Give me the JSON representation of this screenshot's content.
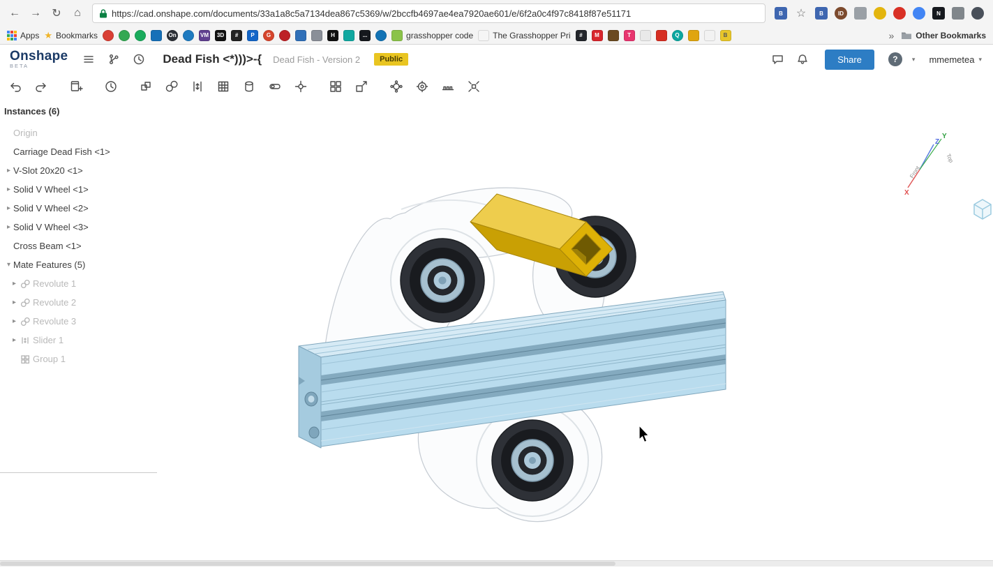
{
  "browser": {
    "url": "https://cad.onshape.com/documents/33a1a8c5a7134dea867c5369/w/2bccfb4697ae4ea7920ae601/e/6f2a0c4f97c8418f87e51171",
    "extensions": [
      {
        "letter": "B",
        "color": "#3e66b0"
      },
      {
        "letter": "ID",
        "color": "#7c4a2d",
        "shape": "circle"
      },
      {
        "letter": "",
        "color": "#9aa0a6"
      },
      {
        "letter": "",
        "color": "#e3b50e",
        "shape": "circle"
      },
      {
        "letter": "",
        "color": "#d93025",
        "shape": "circle"
      },
      {
        "letter": "",
        "color": "#4285f4",
        "shape": "circle"
      },
      {
        "letter": "N",
        "color": "#16191e"
      },
      {
        "letter": "",
        "color": "#80868b"
      },
      {
        "letter": "",
        "color": "#49505a",
        "shape": "circle"
      }
    ],
    "bookmarks": {
      "apps": "Apps",
      "bookmarks_label": "Bookmarks",
      "left_favicons": [
        {
          "letter": "",
          "color": "#d93f34",
          "shape": "circle"
        },
        {
          "letter": "",
          "color": "#34a853",
          "shape": "circle"
        },
        {
          "letter": "",
          "color": "#1aab5c",
          "shape": "circle"
        },
        {
          "letter": "",
          "color": "#1670b8"
        },
        {
          "letter": "On",
          "color": "#2b2f36",
          "shape": "circle"
        },
        {
          "letter": "",
          "color": "#1f7bc0",
          "shape": "circle"
        },
        {
          "letter": "VM",
          "color": "#5f3f8f"
        },
        {
          "letter": "3D",
          "color": "#111111"
        },
        {
          "letter": "#",
          "color": "#222222"
        },
        {
          "letter": "P",
          "color": "#1466c8"
        },
        {
          "letter": "G",
          "color": "#d6452c",
          "shape": "circle"
        },
        {
          "letter": "",
          "color": "#bd2126",
          "shape": "circle"
        },
        {
          "letter": "",
          "color": "#2f6fb8"
        },
        {
          "letter": "",
          "color": "#8a8f98"
        },
        {
          "letter": "H",
          "color": "#101010"
        },
        {
          "letter": "",
          "color": "#11a8a0"
        },
        {
          "letter": "...",
          "color": "#15181d"
        },
        {
          "letter": "",
          "color": "#1273b5",
          "shape": "circle"
        }
      ],
      "grasshopper": "grasshopper code",
      "grasshopper_icon_color": "#8bc34a",
      "grasshopper_pri": "The Grasshopper Pri",
      "page_icon_color": "#f5f5f5",
      "right_favicons": [
        {
          "letter": "#",
          "color": "#23262b"
        },
        {
          "letter": "M",
          "color": "#d8262c"
        },
        {
          "letter": "",
          "color": "#6b4a21"
        },
        {
          "letter": "T",
          "color": "#e8356f"
        },
        {
          "letter": "",
          "color": "#e9e9e9"
        },
        {
          "letter": "",
          "color": "#d62e22"
        },
        {
          "letter": "Q",
          "color": "#0ba7a0",
          "shape": "circle"
        },
        {
          "letter": "",
          "color": "#e0a50f"
        },
        {
          "letter": "",
          "color": "#f2f2f2"
        },
        {
          "letter": "B",
          "color": "#e8c62a"
        }
      ],
      "overflow": "»",
      "other": "Other Bookmarks"
    }
  },
  "header": {
    "logo": "Onshape",
    "beta": "BETA",
    "title": "Dead Fish <*)))>-{",
    "subtitle": "Dead Fish - Version 2",
    "badge": "Public",
    "share_label": "Share",
    "help_glyph": "?",
    "username": "mmemetea"
  },
  "toolbar": {
    "groups": [
      {
        "items": [
          "undo-icon",
          "redo-icon"
        ]
      },
      {
        "items": [
          "insert-icon"
        ]
      },
      {
        "items": [
          "history-icon"
        ]
      },
      {
        "items": [
          "fastened-mate-icon",
          "revolute-mate-icon",
          "slider-mate-icon",
          "planar-mate-icon",
          "cylindrical-mate-icon",
          "pin-slot-mate-icon",
          "ball-mate-icon"
        ]
      },
      {
        "items": [
          "group-icon",
          "replicate-icon"
        ]
      },
      {
        "items": [
          "gear-relation-icon",
          "screw-relation-icon",
          "rack-pinion-icon",
          "exploded-view-icon"
        ]
      }
    ]
  },
  "instances": {
    "title": "Instances (6)",
    "items": [
      {
        "label": "Origin",
        "grayed": true,
        "arrow": "none",
        "icon": null,
        "indent": 0
      },
      {
        "label": "Carriage Dead Fish <1>",
        "grayed": false,
        "arrow": "none",
        "icon": null,
        "indent": 0
      },
      {
        "label": "V-Slot 20x20 <1>",
        "grayed": false,
        "arrow": "right",
        "icon": null,
        "indent": 0
      },
      {
        "label": "Solid V Wheel <1>",
        "grayed": false,
        "arrow": "right",
        "icon": null,
        "indent": 0
      },
      {
        "label": "Solid V Wheel <2>",
        "grayed": false,
        "arrow": "right",
        "icon": null,
        "indent": 0
      },
      {
        "label": "Solid V Wheel <3>",
        "grayed": false,
        "arrow": "right",
        "icon": null,
        "indent": 0
      },
      {
        "label": "Cross Beam <1>",
        "grayed": false,
        "arrow": "none",
        "icon": null,
        "indent": 0
      },
      {
        "label": "Mate Features (5)",
        "grayed": false,
        "arrow": "down",
        "icon": null,
        "indent": 0
      },
      {
        "label": "Revolute 1",
        "grayed": true,
        "arrow": "right",
        "icon": "revolute",
        "indent": 1
      },
      {
        "label": "Revolute 2",
        "grayed": true,
        "arrow": "right",
        "icon": "revolute",
        "indent": 1
      },
      {
        "label": "Revolute 3",
        "grayed": true,
        "arrow": "right",
        "icon": "revolute",
        "indent": 1
      },
      {
        "label": "Slider 1",
        "grayed": true,
        "arrow": "right",
        "icon": "slider",
        "indent": 1
      },
      {
        "label": "Group 1",
        "grayed": true,
        "arrow": "none",
        "icon": "group",
        "indent": 1
      }
    ]
  },
  "viewport": {
    "triad": {
      "x": "X",
      "y": "Y",
      "z": "Z",
      "front": "Front",
      "top": "Top"
    },
    "colors": {
      "rail": "#b9dcee",
      "beam": "#ddb106",
      "wheel": "#2e3137",
      "accent_share": "#2d7dc4",
      "badge": "#e9c521"
    }
  }
}
